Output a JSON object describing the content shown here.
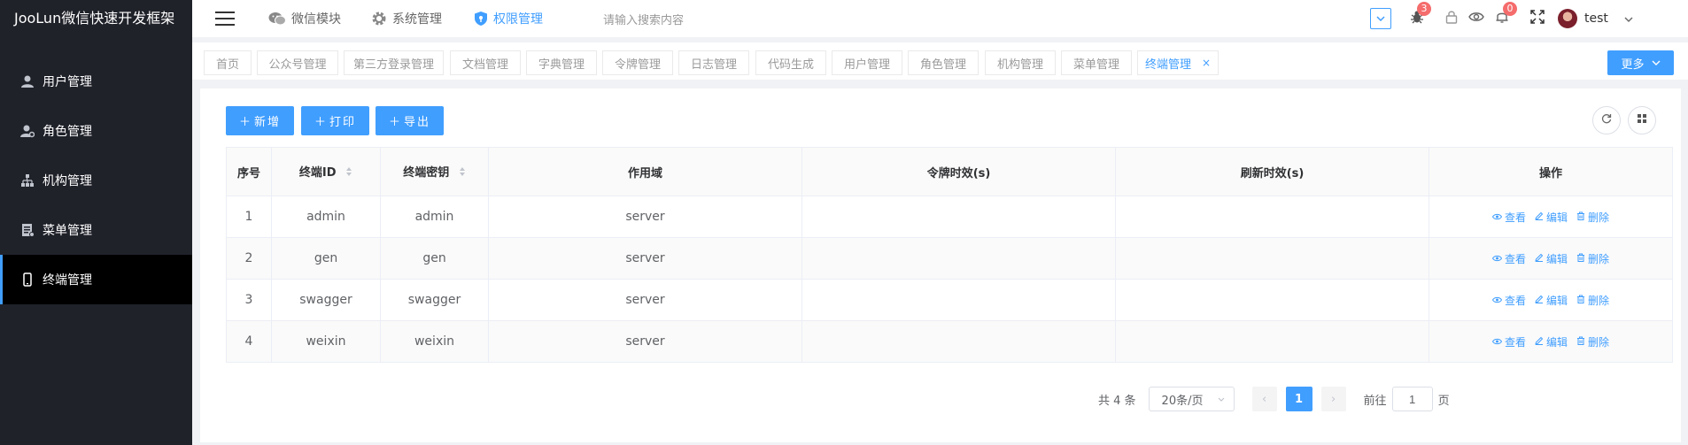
{
  "app": {
    "title": "JooLun微信快速开发框架"
  },
  "sidebar": {
    "items": [
      {
        "label": "用户管理",
        "icon": "user-icon"
      },
      {
        "label": "角色管理",
        "icon": "role-icon"
      },
      {
        "label": "机构管理",
        "icon": "org-icon"
      },
      {
        "label": "菜单管理",
        "icon": "menu-icon"
      },
      {
        "label": "终端管理",
        "icon": "mobile-icon",
        "active": true
      }
    ]
  },
  "header": {
    "nav": [
      {
        "label": "微信模块",
        "icon": "wechat-icon"
      },
      {
        "label": "系统管理",
        "icon": "gear-icon"
      },
      {
        "label": "权限管理",
        "icon": "shield-icon",
        "active": true
      }
    ],
    "search_placeholder": "请输入搜索内容",
    "bug_count": "3",
    "notice_count": "0",
    "username": "test"
  },
  "tabs": {
    "items": [
      "首页",
      "公众号管理",
      "第三方登录管理",
      "文档管理",
      "字典管理",
      "令牌管理",
      "日志管理",
      "代码生成",
      "用户管理",
      "角色管理",
      "机构管理",
      "菜单管理",
      "终端管理"
    ],
    "active": "终端管理",
    "close": "×",
    "more_label": "更多"
  },
  "toolbar": {
    "add_label": "新增",
    "print_label": "打印",
    "export_label": "导出"
  },
  "table": {
    "columns": [
      "序号",
      "终端ID",
      "终端密钥",
      "作用域",
      "令牌时效(s)",
      "刷新时效(s)",
      "操作"
    ],
    "rows": [
      [
        "1",
        "admin",
        "admin",
        "server",
        "",
        ""
      ],
      [
        "2",
        "gen",
        "gen",
        "server",
        "",
        ""
      ],
      [
        "3",
        "swagger",
        "swagger",
        "server",
        "",
        ""
      ],
      [
        "4",
        "weixin",
        "weixin",
        "server",
        "",
        ""
      ]
    ],
    "actions": {
      "view": "查看",
      "edit": "编辑",
      "delete": "删除"
    }
  },
  "pagination": {
    "total_text": "共 4 条",
    "page_size": "20条/页",
    "current_page": "1",
    "goto_label": "前往",
    "goto_value": "1",
    "page_unit": "页"
  }
}
